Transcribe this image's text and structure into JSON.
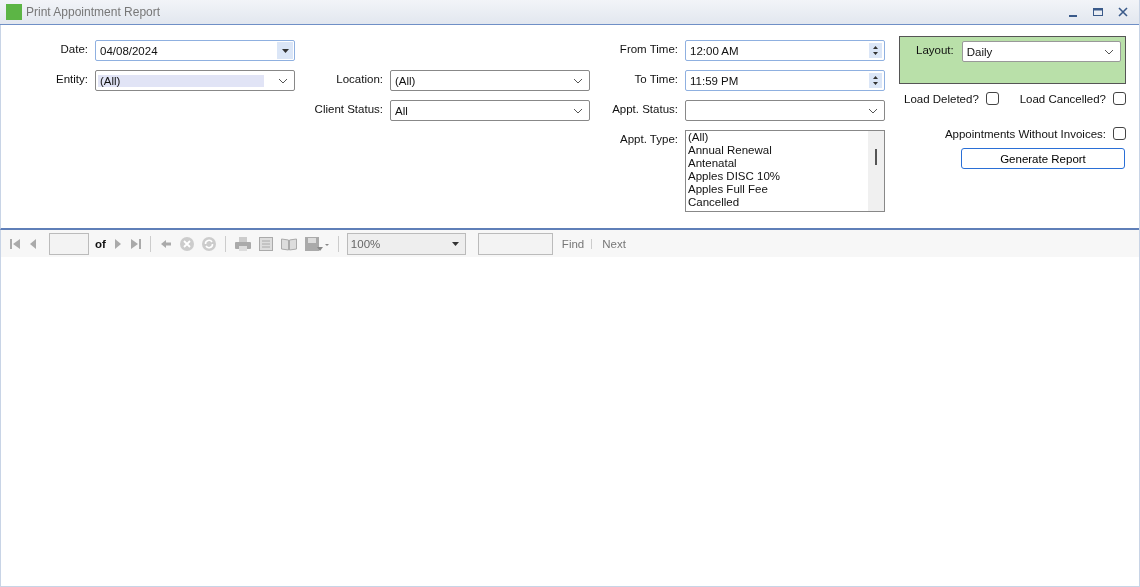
{
  "window": {
    "title": "Print Appointment Report"
  },
  "form": {
    "date": {
      "label": "Date:",
      "value": "04/08/2024"
    },
    "entity": {
      "label": "Entity:",
      "value": "(All)",
      "text_selected": true
    },
    "location": {
      "label": "Location:",
      "value": "(All)"
    },
    "client_status": {
      "label": "Client Status:",
      "value": "All"
    },
    "from_time": {
      "label": "From Time:",
      "value": "12:00 AM"
    },
    "to_time": {
      "label": "To Time:",
      "value": "11:59 PM"
    },
    "appt_status": {
      "label": "Appt. Status:"
    },
    "appt_type": {
      "label": "Appt. Type:",
      "items": [
        "(All)",
        "Annual Renewal",
        "Antenatal",
        "Apples DISC 10%",
        "Apples Full Fee",
        "Cancelled"
      ]
    },
    "layout": {
      "label": "Layout:",
      "value": "Daily"
    },
    "load_deleted": {
      "label": "Load Deleted?",
      "checked": false
    },
    "load_cancelled": {
      "label": "Load Cancelled?",
      "checked": false
    },
    "without_invoices": {
      "label": "Appointments Without Invoices:",
      "checked": false
    },
    "generate_button": "Generate Report"
  },
  "toolbar": {
    "of_label": "of",
    "zoom": "100%",
    "find": "Find",
    "next": "Next"
  }
}
